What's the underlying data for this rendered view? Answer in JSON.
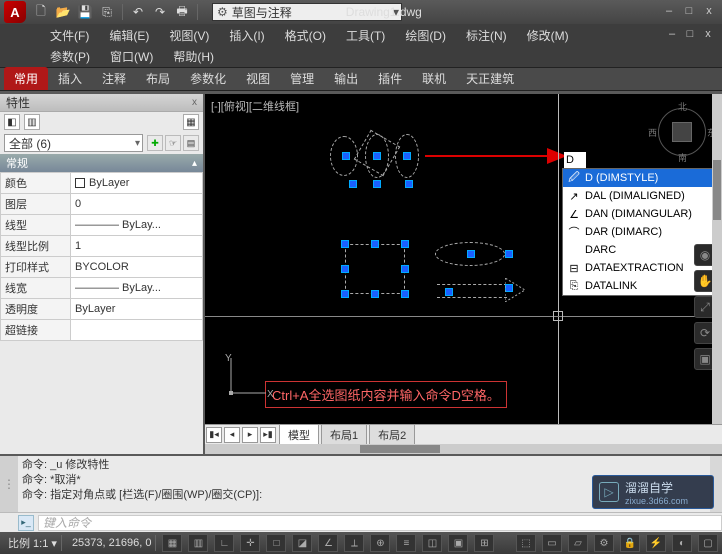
{
  "app": {
    "logo": "A",
    "doc_title": "Drawing1.dwg"
  },
  "qat_dropdown": {
    "text": "草图与注释"
  },
  "window_buttons": {
    "min": "–",
    "max": "□",
    "close": "x"
  },
  "doc_window_buttons": {
    "min": "–",
    "max": "□",
    "close": "x"
  },
  "menubar1": [
    "文件(F)",
    "编辑(E)",
    "视图(V)",
    "插入(I)",
    "格式(O)",
    "工具(T)",
    "绘图(D)",
    "标注(N)",
    "修改(M)"
  ],
  "menubar2": [
    "参数(P)",
    "窗口(W)",
    "帮助(H)"
  ],
  "ribbon_tabs": [
    {
      "label": "常用",
      "active": true
    },
    {
      "label": "插入"
    },
    {
      "label": "注释"
    },
    {
      "label": "布局"
    },
    {
      "label": "参数化"
    },
    {
      "label": "视图"
    },
    {
      "label": "管理"
    },
    {
      "label": "输出"
    },
    {
      "label": "插件"
    },
    {
      "label": "联机"
    },
    {
      "label": "天正建筑"
    }
  ],
  "palette": {
    "title": "特性",
    "selection": "全部 (6)",
    "section": "常规",
    "rows": [
      {
        "label": "颜色",
        "value": "ByLayer",
        "swatch": true
      },
      {
        "label": "图层",
        "value": "0"
      },
      {
        "label": "线型",
        "value": "———— ByLay..."
      },
      {
        "label": "线型比例",
        "value": "1"
      },
      {
        "label": "打印样式",
        "value": "BYCOLOR"
      },
      {
        "label": "线宽",
        "value": "———— ByLay..."
      },
      {
        "label": "透明度",
        "value": "ByLayer"
      },
      {
        "label": "超链接",
        "value": ""
      }
    ]
  },
  "viewport": {
    "label": "[-][俯视][二维线框]",
    "navcube": {
      "n": "北",
      "s": "南",
      "e": "东",
      "w": "西"
    },
    "ucs": {
      "x": "X",
      "y": "Y"
    },
    "annotation": "Ctrl+A全选图纸内容并输入命令D空格。",
    "number_glyphs": "300"
  },
  "command_overlay": {
    "typed": "D"
  },
  "autocomplete": [
    {
      "text": "D (DIMSTYLE)",
      "selected": true,
      "icon": "dimstyle"
    },
    {
      "text": "DAL (DIMALIGNED)",
      "icon": "aligned"
    },
    {
      "text": "DAN (DIMANGULAR)",
      "icon": "angle"
    },
    {
      "text": "DAR (DIMARC)",
      "icon": "arc"
    },
    {
      "text": "DARC",
      "icon": "none"
    },
    {
      "text": "DATAEXTRACTION",
      "icon": "extract"
    },
    {
      "text": "DATALINK",
      "icon": "link"
    }
  ],
  "layout_tabs": {
    "active": "模型",
    "tabs": [
      "模型",
      "布局1",
      "布局2"
    ]
  },
  "command_window": {
    "lines": [
      "命令: _u 修改特性",
      "命令: *取消*",
      "命令: 指定对角点或 [栏选(F)/圈围(WP)/圈交(CP)]:"
    ],
    "input_placeholder": "键入命令"
  },
  "statusbar": {
    "scale": "比例 1:1 ▾",
    "coords": "25373, 21696, 0"
  },
  "watermark": {
    "line1": "溜溜自学",
    "line2": "zixue.3d66.com"
  }
}
